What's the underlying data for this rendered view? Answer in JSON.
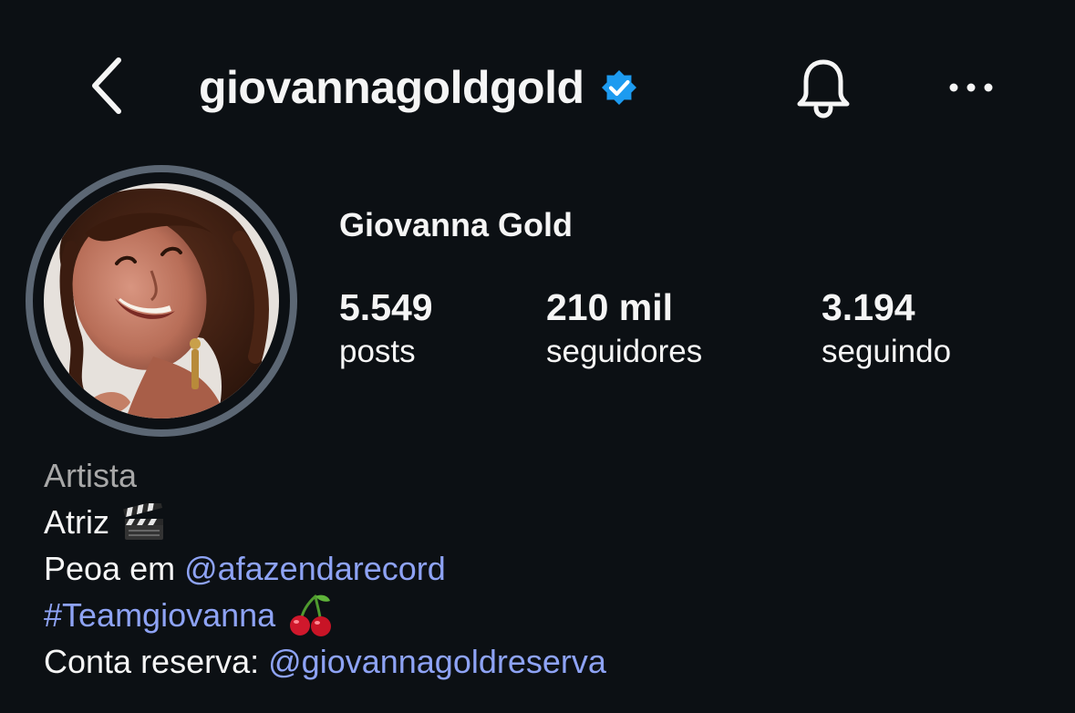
{
  "header": {
    "username": "giovannagoldgold",
    "verified_color": "#1d9bf0",
    "icons": [
      "chevron-left-icon",
      "verified-badge-icon",
      "bell-icon",
      "more-horizontal-icon"
    ]
  },
  "profile": {
    "display_name": "Giovanna Gold",
    "stats": [
      {
        "value": "5.549",
        "label": "posts"
      },
      {
        "value": "210 mil",
        "label": "seguidores"
      },
      {
        "value": "3.194",
        "label": "seguindo"
      }
    ]
  },
  "bio": {
    "category": "Artista",
    "line1_text": "Atriz",
    "line1_emoji": "clapper-board-icon",
    "line2_prefix": "Peoa em ",
    "line2_mention": "@afazendarecord",
    "line3_hashtag": "#Teamgiovanna",
    "line3_emoji": "cherries-icon",
    "line4_prefix": "Conta reserva: ",
    "line4_mention": "@giovannagoldreserva"
  },
  "colors": {
    "background": "#0c1014",
    "text": "#f5f5f5",
    "secondary_text": "#a8a8a8",
    "link": "#8ea3f5",
    "avatar_ring": "#5c6774"
  }
}
